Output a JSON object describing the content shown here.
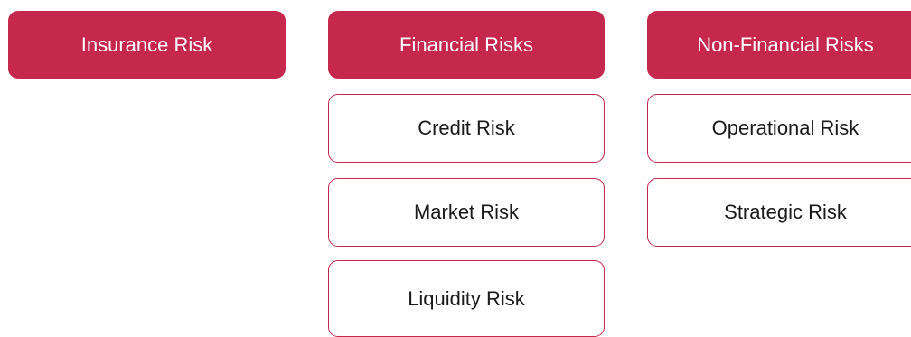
{
  "colors": {
    "header_fill": "#c5274d",
    "header_text": "#ffffff",
    "sub_border": "#c5274d",
    "sub_text": "#1a1a1a"
  },
  "columns": [
    {
      "header": "Insurance Risk",
      "items": []
    },
    {
      "header": "Financial Risks",
      "items": [
        "Credit Risk",
        "Market Risk",
        "Liquidity Risk"
      ]
    },
    {
      "header": "Non-Financial Risks",
      "items": [
        "Operational Risk",
        "Strategic Risk"
      ]
    }
  ]
}
